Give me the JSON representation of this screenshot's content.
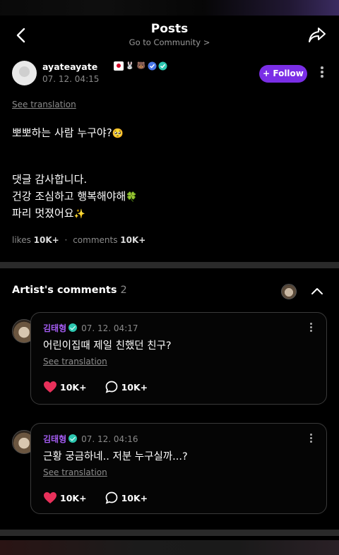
{
  "header": {
    "title": "Posts",
    "subtitle": "Go to Community >"
  },
  "post": {
    "author": "ayateayate",
    "author_badges": [
      "japan-flag",
      "rabbit",
      "bear",
      "verified",
      "verified"
    ],
    "timestamp": "07. 12. 04:15",
    "follow_label": "+ Follow",
    "see_translation": "See translation",
    "lines": [
      "뽀뽀하는 사람 누구야?",
      "",
      "댓글 감사합니다.",
      "건강 조심하고 행복해야해",
      "파리 멋졌어요"
    ],
    "line_emojis": [
      "🥺",
      "",
      "",
      "🍀",
      "✨"
    ],
    "likes_label": "likes",
    "likes_value": "10K+",
    "comments_label": "comments",
    "comments_value": "10K+"
  },
  "artist_comments": {
    "title": "Artist's comments",
    "count": "2",
    "items": [
      {
        "author": "김태형",
        "timestamp": "07. 12. 04:17",
        "text": "어린이집때 제일 친했던 친구?",
        "see_translation": "See translation",
        "likes": "10K+",
        "replies": "10K+"
      },
      {
        "author": "김태형",
        "timestamp": "07. 12. 04:16",
        "text": "근황 궁금하네.. 저분 누구실까...?",
        "see_translation": "See translation",
        "likes": "10K+",
        "replies": "10K+"
      }
    ]
  },
  "colors": {
    "accent": "#7a2ee6",
    "artist_name": "#a45cf2",
    "heart": "#e8305a",
    "verified": "#2cc7b0"
  }
}
